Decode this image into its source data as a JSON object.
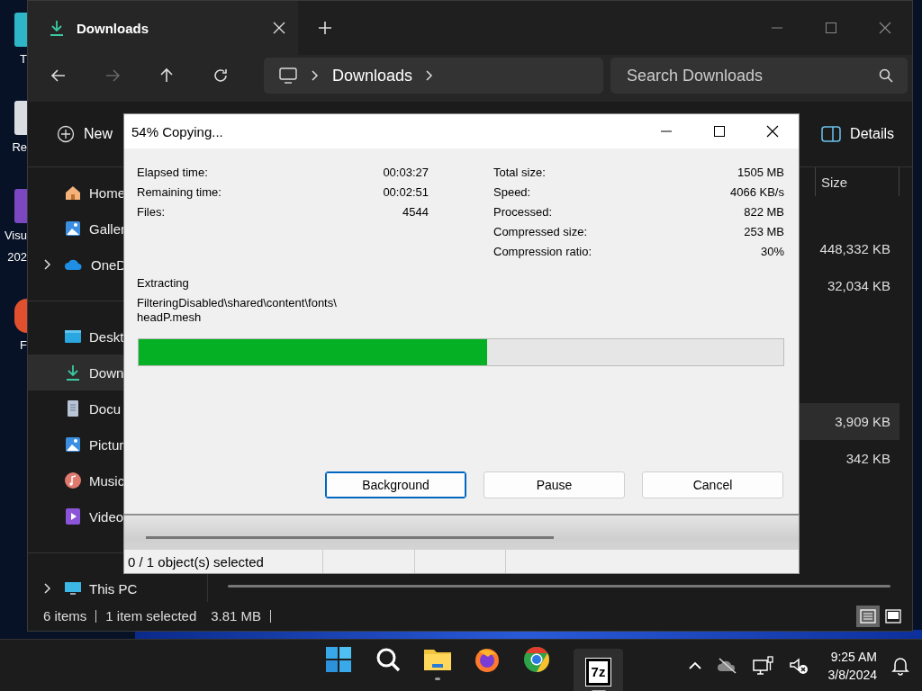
{
  "desktop": {
    "icons": [
      {
        "kind": "app",
        "label_lines": [
          "T"
        ]
      },
      {
        "kind": "recycle",
        "label_lines": [
          "Re"
        ]
      },
      {
        "kind": "ide",
        "label_lines": [
          "Visu",
          "202"
        ]
      },
      {
        "kind": "shortcut",
        "label_lines": [
          "F"
        ]
      }
    ]
  },
  "explorer": {
    "tab": {
      "title": "Downloads"
    },
    "nav": [
      {
        "kind": "back",
        "disabled": false
      },
      {
        "kind": "forward",
        "disabled": true
      },
      {
        "kind": "up",
        "disabled": false
      },
      {
        "kind": "refresh",
        "disabled": false
      }
    ],
    "address": {
      "segments": [
        "Downloads"
      ]
    },
    "search": {
      "placeholder": "Search Downloads"
    },
    "toolbar": {
      "new": "New",
      "details": "Details"
    },
    "sidebar": {
      "sections": [
        [
          {
            "kind": "home",
            "label": "Home",
            "selected": false,
            "expandable": false
          },
          {
            "kind": "gallery",
            "label": "Galler",
            "selected": false,
            "expandable": false
          },
          {
            "kind": "cloud",
            "label": "OneD",
            "selected": false,
            "expandable": true
          }
        ],
        [
          {
            "kind": "desktop",
            "label": "Deskt",
            "selected": false,
            "expandable": false
          },
          {
            "kind": "download",
            "label": "Down",
            "selected": true,
            "expandable": false
          },
          {
            "kind": "document",
            "label": "Docu",
            "selected": false,
            "expandable": false
          },
          {
            "kind": "gallery",
            "label": "Pictur",
            "selected": false,
            "expandable": false
          },
          {
            "kind": "music",
            "label": "Music",
            "selected": false,
            "expandable": false
          },
          {
            "kind": "video",
            "label": "Video",
            "selected": false,
            "expandable": false
          }
        ],
        [
          {
            "kind": "pc",
            "label": "This PC",
            "selected": false,
            "expandable": true
          }
        ]
      ]
    },
    "column": "Size",
    "rows": [
      {
        "size": "448,332 KB",
        "selected": false,
        "new_group": false
      },
      {
        "size": "32,034 KB",
        "selected": false,
        "new_group": false
      },
      {
        "size": "3,909 KB",
        "selected": true,
        "new_group": true
      },
      {
        "size": "342 KB",
        "selected": false,
        "new_group": false
      }
    ],
    "status": [
      "6 items",
      "1 item selected",
      "3.81 MB"
    ],
    "view_buttons": [
      {
        "kind": "details",
        "selected": true
      },
      {
        "kind": "tiles",
        "selected": false
      }
    ]
  },
  "dialog": {
    "title": "54% Copying...",
    "left_stats": [
      {
        "label": "Elapsed time:",
        "value": "00:03:27"
      },
      {
        "label": "Remaining time:",
        "value": "00:02:51"
      },
      {
        "label": "Files:",
        "value": "4544"
      }
    ],
    "right_stats": [
      {
        "label": "Total size:",
        "value": "1505 MB"
      },
      {
        "label": "Speed:",
        "value": "4066 KB/s"
      },
      {
        "label": "Processed:",
        "value": "822 MB"
      },
      {
        "label": "Compressed size:",
        "value": "253 MB"
      },
      {
        "label": "Compression ratio:",
        "value": "30%"
      }
    ],
    "action": "Extracting",
    "path_lines": [
      "FilteringDisabled\\shared\\content\\fonts\\",
      "headP.mesh"
    ],
    "level": 0.54,
    "buttons": [
      {
        "label": "Background",
        "focused": true
      },
      {
        "label": "Pause",
        "focused": false
      },
      {
        "label": "Cancel",
        "focused": false
      }
    ]
  },
  "archiver": {
    "status": "0 / 1 object(s) selected"
  },
  "taskbar": {
    "items": [
      {
        "kind": "start",
        "running": false,
        "active": false
      },
      {
        "kind": "search",
        "running": false,
        "active": false
      },
      {
        "kind": "folder",
        "running": true,
        "active": false
      },
      {
        "kind": "firefox",
        "running": false,
        "active": false
      },
      {
        "kind": "chrome",
        "running": false,
        "active": false
      },
      {
        "kind": "archiver",
        "label": "7z",
        "running": true,
        "active": true
      }
    ],
    "tray": [
      {
        "kind": "chevron"
      },
      {
        "kind": "cloud-off"
      },
      {
        "kind": "network"
      },
      {
        "kind": "speaker-muted"
      }
    ],
    "time": "9:25 AM",
    "date": "3/8/2024"
  }
}
